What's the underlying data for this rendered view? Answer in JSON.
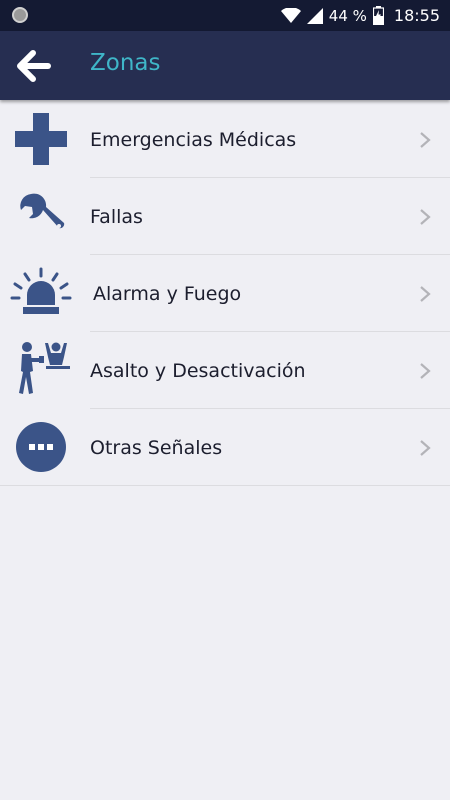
{
  "status": {
    "battery_percent": "44 %",
    "time": "18:55"
  },
  "header": {
    "title": "Zonas",
    "back_icon": "arrow-left-icon"
  },
  "menu": {
    "items": [
      {
        "label": "Emergencias Médicas",
        "icon": "medical-cross-icon"
      },
      {
        "label": "Fallas",
        "icon": "wrench-icon"
      },
      {
        "label": "Alarma y Fuego",
        "icon": "siren-icon"
      },
      {
        "label": "Asalto y Desactivación",
        "icon": "robbery-icon"
      },
      {
        "label": "Otras Señales",
        "icon": "more-dots-icon"
      }
    ]
  },
  "colors": {
    "status_bar": "#141a33",
    "app_bar": "#262e51",
    "title_accent": "#3fb6c8",
    "icon_blue": "#3b5488",
    "background": "#efeff4"
  }
}
